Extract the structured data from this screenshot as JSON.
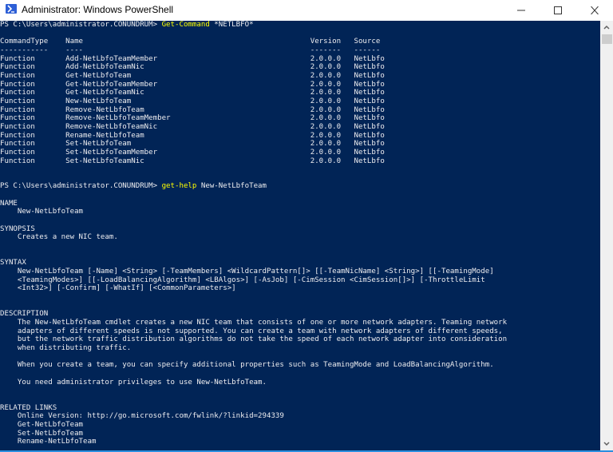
{
  "window": {
    "title": "Administrator: Windows PowerShell",
    "icon": "powershell-icon",
    "controls": {
      "minimize": "minimize-icon",
      "maximize": "maximize-icon",
      "close": "close-icon"
    }
  },
  "colors": {
    "console_bg": "#012456",
    "text": "#eeedf0",
    "command": "#ffff00",
    "accent_border": "#2b8ee0"
  },
  "prompts": [
    {
      "prompt": "PS C:\\Users\\administrator.CONUNDRUM> ",
      "command": "Get-Command",
      "args": " *NETLBFO*"
    },
    {
      "prompt": "PS C:\\Users\\administrator.CONUNDRUM> ",
      "command": "get-help",
      "args": " New-NetLbfoTeam"
    }
  ],
  "table": {
    "headers": [
      "CommandType",
      "Name",
      "Version",
      "Source"
    ],
    "underlines": [
      "-----------",
      "----",
      "-------",
      "------"
    ],
    "rows": [
      [
        "Function",
        "Add-NetLbfoTeamMember",
        "2.0.0.0",
        "NetLbfo"
      ],
      [
        "Function",
        "Add-NetLbfoTeamNic",
        "2.0.0.0",
        "NetLbfo"
      ],
      [
        "Function",
        "Get-NetLbfoTeam",
        "2.0.0.0",
        "NetLbfo"
      ],
      [
        "Function",
        "Get-NetLbfoTeamMember",
        "2.0.0.0",
        "NetLbfo"
      ],
      [
        "Function",
        "Get-NetLbfoTeamNic",
        "2.0.0.0",
        "NetLbfo"
      ],
      [
        "Function",
        "New-NetLbfoTeam",
        "2.0.0.0",
        "NetLbfo"
      ],
      [
        "Function",
        "Remove-NetLbfoTeam",
        "2.0.0.0",
        "NetLbfo"
      ],
      [
        "Function",
        "Remove-NetLbfoTeamMember",
        "2.0.0.0",
        "NetLbfo"
      ],
      [
        "Function",
        "Remove-NetLbfoTeamNic",
        "2.0.0.0",
        "NetLbfo"
      ],
      [
        "Function",
        "Rename-NetLbfoTeam",
        "2.0.0.0",
        "NetLbfo"
      ],
      [
        "Function",
        "Set-NetLbfoTeam",
        "2.0.0.0",
        "NetLbfo"
      ],
      [
        "Function",
        "Set-NetLbfoTeamMember",
        "2.0.0.0",
        "NetLbfo"
      ],
      [
        "Function",
        "Set-NetLbfoTeamNic",
        "2.0.0.0",
        "NetLbfo"
      ]
    ]
  },
  "help": {
    "name_heading": "NAME",
    "name": "    New-NetLbfoTeam",
    "synopsis_heading": "SYNOPSIS",
    "synopsis": "    Creates a new NIC team.",
    "syntax_heading": "SYNTAX",
    "syntax": [
      "    New-NetLbfoTeam [-Name] <String> [-TeamMembers] <WildcardPattern[]> [[-TeamNicName] <String>] [[-TeamingMode]",
      "    <TeamingModes>] [[-LoadBalancingAlgorithm] <LBAlgos>] [-AsJob] [-CimSession <CimSession[]>] [-ThrottleLimit",
      "    <Int32>] [-Confirm] [-WhatIf] [<CommonParameters>]"
    ],
    "description_heading": "DESCRIPTION",
    "description": [
      "    The New-NetLbfoTeam cmdlet creates a new NIC team that consists of one or more network adapters. Teaming network",
      "    adapters of different speeds is not supported. You can create a team with network adapters of different speeds,",
      "    but the network traffic distribution algorithms do not take the speed of each network adapter into consideration",
      "    when distributing traffic."
    ],
    "description_p2": "    When you create a team, you can specify additional properties such as TeamingMode and LoadBalancingAlgorithm.",
    "description_p3": "    You need administrator privileges to use New-NetLbfoTeam.",
    "related_heading": "RELATED LINKS",
    "related": [
      "    Online Version: http://go.microsoft.com/fwlink/?linkid=294339",
      "    Get-NetLbfoTeam",
      "    Set-NetLbfoTeam",
      "    Rename-NetLbfoTeam"
    ]
  },
  "scrollbar": {
    "up": "chevron-up-icon",
    "down": "chevron-down-icon",
    "position_fraction": 0.0
  }
}
